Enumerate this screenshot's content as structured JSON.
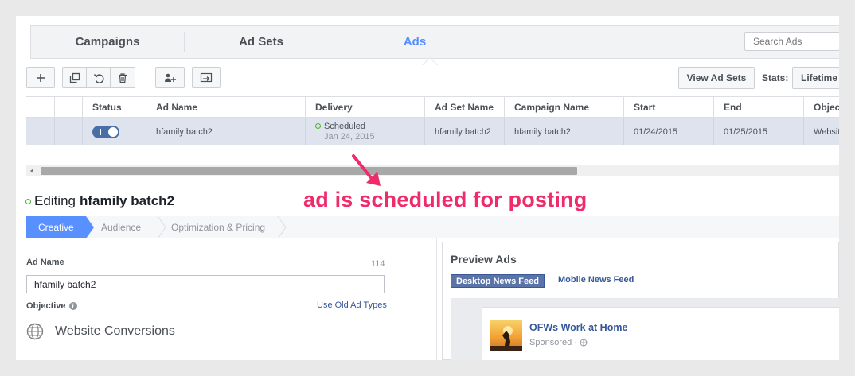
{
  "tabs": [
    {
      "label": "Campaigns",
      "active": false
    },
    {
      "label": "Ad Sets",
      "active": false
    },
    {
      "label": "Ads",
      "active": true
    }
  ],
  "search": {
    "placeholder": "Search Ads"
  },
  "toolbar": {
    "add_icon": "plus-icon",
    "icons": [
      "duplicate-icon",
      "undo-icon",
      "trash-icon",
      "add-people-icon",
      "export-icon"
    ],
    "view_ad_sets_label": "View Ad Sets",
    "stats_label": "Stats:",
    "stats_value": "Lifetime"
  },
  "table": {
    "columns": [
      "Status",
      "Ad Name",
      "Delivery",
      "Ad Set Name",
      "Campaign Name",
      "Start",
      "End",
      "Objective"
    ],
    "rows": [
      {
        "status_on": true,
        "ad_name": "hfamily batch2",
        "delivery_status": "Scheduled",
        "delivery_date": "Jan 24, 2015",
        "ad_set_name": "hfamily batch2",
        "campaign_name": "hfamily batch2",
        "start": "01/24/2015",
        "end": "01/25/2015",
        "objective": "Website Conversions"
      }
    ]
  },
  "annotation": {
    "text": "ad is scheduled for posting",
    "color": "#ee2b6b"
  },
  "editing": {
    "prefix": "Editing",
    "name": "hfamily batch2"
  },
  "steps": [
    {
      "label": "Creative",
      "active": true
    },
    {
      "label": "Audience",
      "active": false
    },
    {
      "label": "Optimization & Pricing",
      "active": false
    }
  ],
  "form": {
    "ad_name_label": "Ad Name",
    "char_count": "114",
    "ad_name_value": "hfamily batch2",
    "objective_label": "Objective",
    "use_old_types_link": "Use Old Ad Types",
    "objective_value": "Website Conversions"
  },
  "preview": {
    "title": "Preview Ads",
    "tab_desktop": "Desktop News Feed",
    "tab_mobile": "Mobile News Feed",
    "page_name": "OFWs Work at Home",
    "sponsored": "Sponsored"
  },
  "colors": {
    "accent": "#5890ff",
    "link": "#365899",
    "status_green": "#42b72a"
  }
}
